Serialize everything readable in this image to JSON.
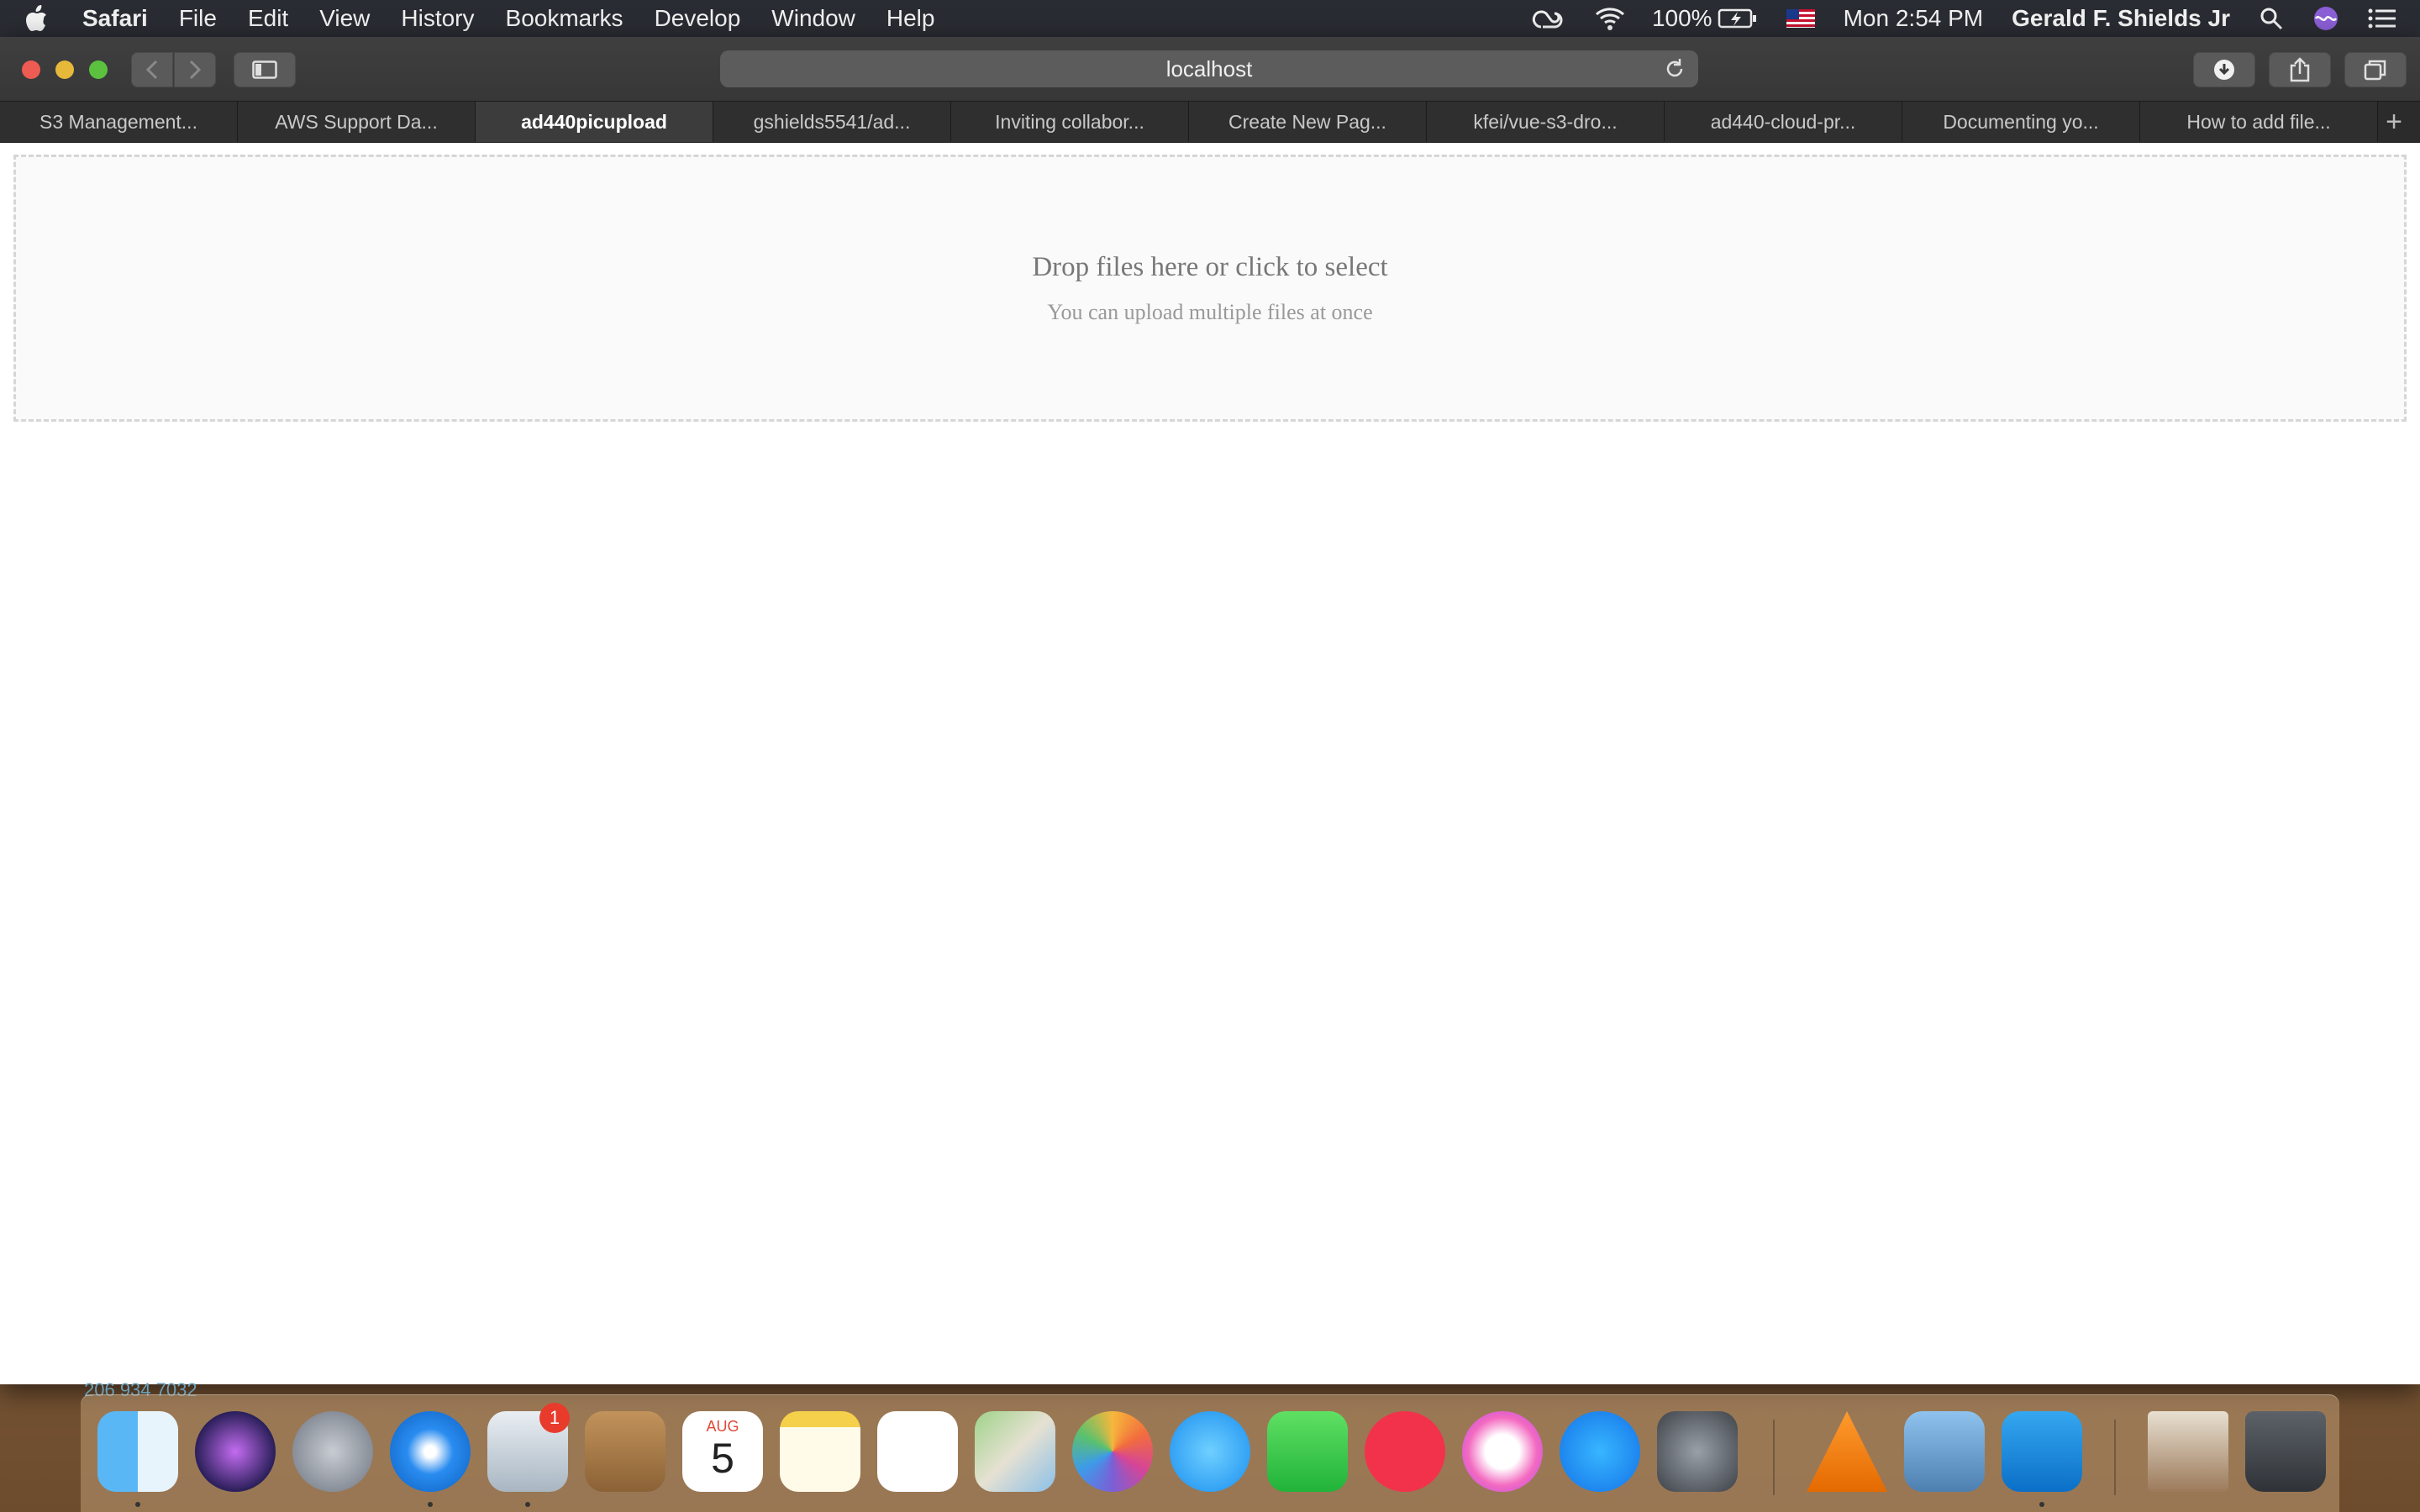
{
  "menubar": {
    "app_name": "Safari",
    "menus": [
      "File",
      "Edit",
      "View",
      "History",
      "Bookmarks",
      "Develop",
      "Window",
      "Help"
    ],
    "battery": "100%",
    "clock": "Mon 2:54 PM",
    "user": "Gerald F. Shields Jr",
    "icons": [
      "apple-icon",
      "creative-cloud-icon",
      "wifi-icon",
      "battery-charging-icon",
      "us-flag-icon",
      "spotlight-search-icon",
      "siri-icon",
      "notification-center-icon"
    ]
  },
  "toolbar": {
    "address": "localhost"
  },
  "tabs": [
    {
      "label": "S3 Management...",
      "active": false
    },
    {
      "label": "AWS Support Da...",
      "active": false
    },
    {
      "label": "ad440picupload",
      "active": true
    },
    {
      "label": "gshields5541/ad...",
      "active": false
    },
    {
      "label": "Inviting collabor...",
      "active": false
    },
    {
      "label": "Create New Pag...",
      "active": false
    },
    {
      "label": "kfei/vue-s3-dro...",
      "active": false
    },
    {
      "label": "ad440-cloud-pr...",
      "active": false
    },
    {
      "label": "Documenting yo...",
      "active": false
    },
    {
      "label": "How to add file...",
      "active": false
    }
  ],
  "newtab": "+",
  "dropzone": {
    "title": "Drop files here or click to select",
    "subtitle": "You can upload multiple files at once"
  },
  "peek_text": "206 934 7032",
  "dock": {
    "badge": "1",
    "calendar_month": "AUG",
    "calendar_day": "5",
    "apps": [
      "finder",
      "siri",
      "launchpad",
      "safari",
      "mail",
      "contacts",
      "calendar",
      "notes",
      "reminders",
      "maps",
      "photos",
      "messages",
      "facetime",
      "news",
      "itunes",
      "app-store",
      "system-preferences",
      "vlc",
      "preview",
      "vscode",
      "photo-stack",
      "trash"
    ]
  },
  "colors": {
    "menubar_bg": "#2a2c33",
    "toolbar_bg": "#3a3a3b",
    "tab_active": "#3c3c3d",
    "close": "#ee5b52",
    "minimize": "#e6b93a",
    "zoom": "#5cc13f"
  }
}
